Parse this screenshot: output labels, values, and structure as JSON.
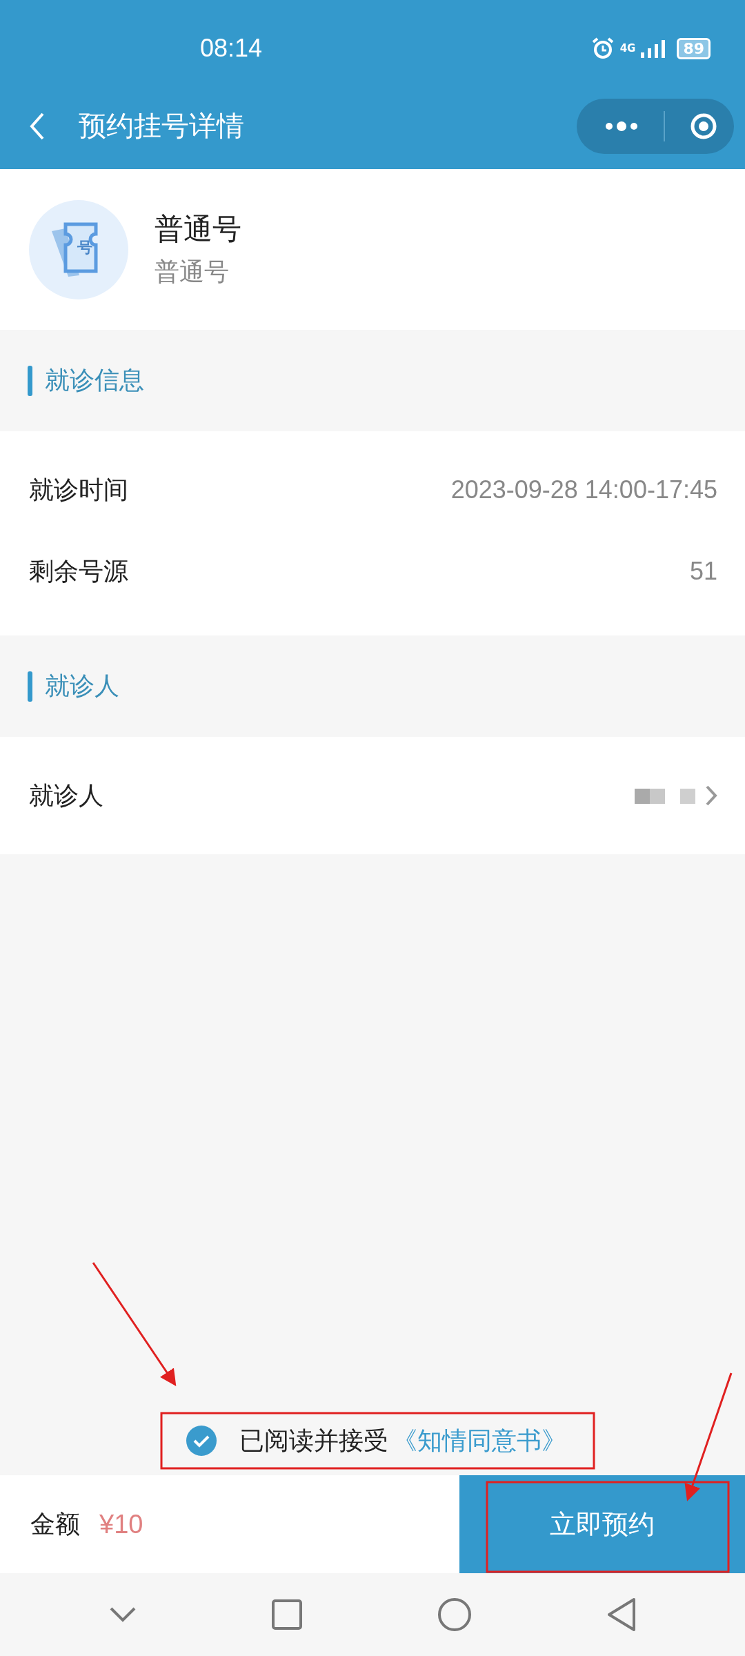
{
  "status_bar": {
    "time": "08:14",
    "network": "4G",
    "battery": "89"
  },
  "nav_bar": {
    "title": "预约挂号详情"
  },
  "ticket": {
    "icon_label": "号",
    "title": "普通号",
    "subtitle": "普通号"
  },
  "sections": [
    {
      "title": "就诊信息",
      "rows": [
        {
          "label": "就诊时间",
          "value": "2023-09-28 14:00-17:45"
        },
        {
          "label": "剩余号源",
          "value": "51"
        }
      ]
    },
    {
      "title": "就诊人",
      "rows": [
        {
          "label": "就诊人",
          "kind": "redacted"
        }
      ]
    }
  ],
  "agreement": {
    "checked": true,
    "text": "已阅读并接受",
    "link": "《知情同意书》"
  },
  "footer": {
    "amount_label": "金额",
    "amount": "¥10",
    "button": "立即预约"
  }
}
